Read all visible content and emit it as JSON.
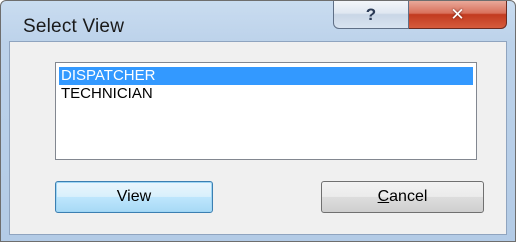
{
  "window": {
    "title": "Select View",
    "help_glyph": "?",
    "close_glyph": "✕"
  },
  "list": {
    "items": [
      {
        "label": "DISPATCHER",
        "selected": true
      },
      {
        "label": "TECHNICIAN",
        "selected": false
      }
    ]
  },
  "buttons": {
    "view_label": "View",
    "cancel_mnemonic": "C",
    "cancel_rest": "ancel"
  },
  "colors": {
    "selection": "#3399ff",
    "close_button": "#c23a1f",
    "frame": "#b3cbe6"
  },
  "icons": [
    "help-icon",
    "close-icon"
  ]
}
